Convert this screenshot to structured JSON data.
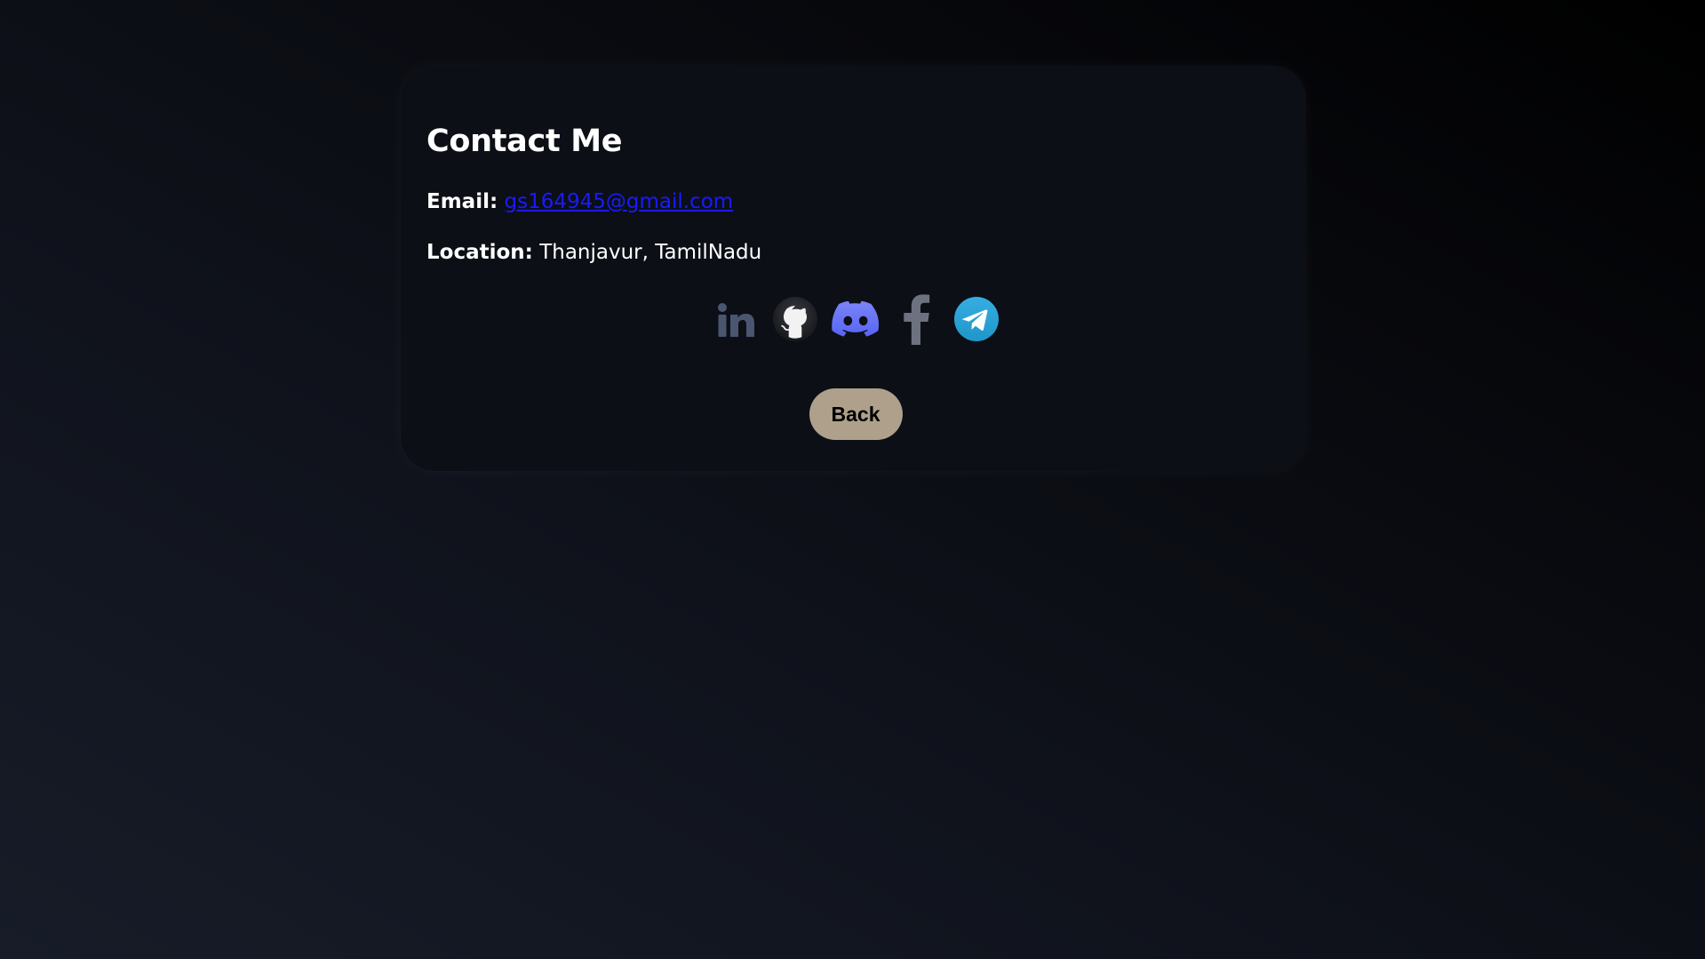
{
  "contact": {
    "title": "Contact Me",
    "email_label": "Email:",
    "email_value": "gs164945@gmail.com",
    "location_label": "Location:",
    "location_value": "Thanjavur, TamilNadu"
  },
  "socials": [
    {
      "name": "linkedin-icon"
    },
    {
      "name": "github-icon"
    },
    {
      "name": "discord-icon"
    },
    {
      "name": "facebook-icon"
    },
    {
      "name": "telegram-icon"
    }
  ],
  "back_button": {
    "label": "Back"
  },
  "colors": {
    "link": "#1a1aff",
    "button_bg": "#aea08a",
    "discord": "#5865f2",
    "telegram": "#2aa3e0",
    "linkedin": "#4a5670",
    "facebook": "#6d7280"
  }
}
